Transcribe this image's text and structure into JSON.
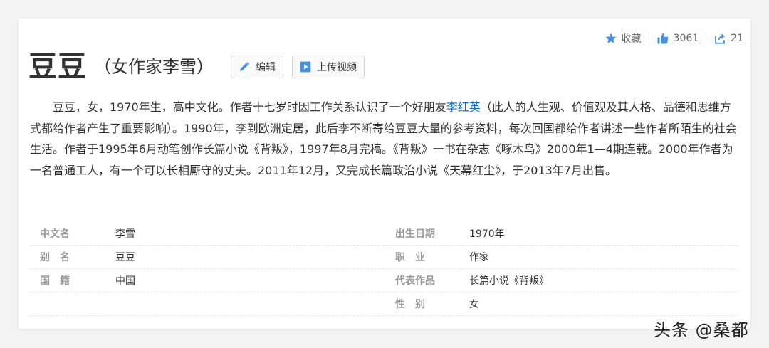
{
  "actions": {
    "favorite_label": "收藏",
    "like_count": "3061",
    "share_count": "21"
  },
  "title": {
    "main": "豆豆",
    "sub": "（女作家李雪）"
  },
  "buttons": {
    "edit": "编辑",
    "upload_video": "上传视频"
  },
  "intro": {
    "before_link": "豆豆，女，1970年生，高中文化。作者十七岁时因工作关系认识了一个好朋友",
    "link": "李红英",
    "after_link": "（此人的人生观、价值观及其人格、品德和思维方式都给作者产生了重要影响）。1990年，李到欧洲定居，此后李不断寄给豆豆大量的参考资料，每次回国都给作者讲述一些作者所陌生的社会生活。作者于1995年6月动笔创作长篇小说《背叛》，1997年8月完稿。《背叛》一书在杂志《啄木鸟》2000年1—4期连载。2000年作者为一名普通工人，有一个可以长相厮守的丈夫。2011年12月，又完成长篇政治小说《天幕红尘》，于2013年7月出售。"
  },
  "info_left": [
    {
      "label": "中文名",
      "value": "李雪"
    },
    {
      "label": "别　名",
      "value": "豆豆"
    },
    {
      "label": "国　籍",
      "value": "中国"
    },
    {
      "label": "",
      "value": ""
    }
  ],
  "info_right": [
    {
      "label": "出生日期",
      "value": "1970年"
    },
    {
      "label": "职　业",
      "value": "作家"
    },
    {
      "label": "代表作品",
      "value": "长篇小说《背叛》"
    },
    {
      "label": "性　别",
      "value": "女"
    }
  ],
  "watermark": "头条 @桑都",
  "colors": {
    "link": "#136ec2",
    "icon": "#4a90d9",
    "label": "#999999"
  }
}
